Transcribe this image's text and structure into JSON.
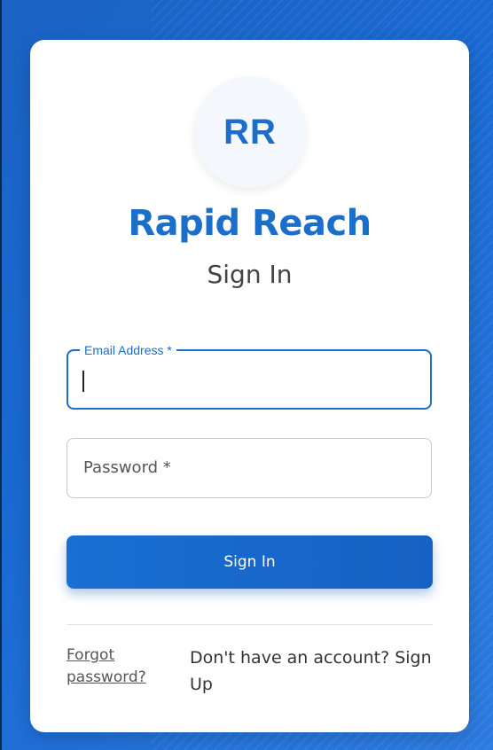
{
  "brand": {
    "initials": "RR",
    "name": "Rapid Reach"
  },
  "form": {
    "heading": "Sign In",
    "email_label": "Email Address *",
    "email_value": "",
    "password_label": "Password *",
    "password_value": "",
    "submit_label": "Sign In"
  },
  "footer": {
    "forgot_label": "Forgot password?",
    "signup_label": "Don't have an account? Sign Up"
  },
  "colors": {
    "accent": "#1b6ec9",
    "background": "#1f6fd0"
  }
}
